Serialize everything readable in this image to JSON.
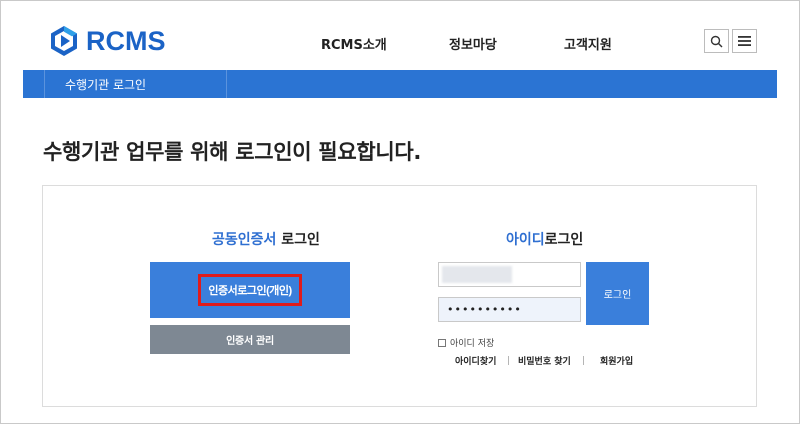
{
  "header": {
    "logo_text": "RCMS",
    "nav": [
      "RCMS소개",
      "정보마당",
      "고객지원"
    ],
    "brand_color": "#1b63c6",
    "icons": {
      "search": "search-icon",
      "menu": "hamburger-menu-icon"
    }
  },
  "breadcrumb": {
    "label": "수행기관 로그인",
    "bar_color": "#2b74d3"
  },
  "page": {
    "title": "수행기관 업무를 위해 로그인이 필요합니다."
  },
  "cert_login": {
    "title_highlight": "공동인증서",
    "title_rest": " 로그인",
    "login_button": "인증서로그인(개인)",
    "manage_button": "인증서 관리"
  },
  "id_login": {
    "title_highlight": "아이디",
    "title_rest": "로그인",
    "id_value": "",
    "password_value": "••••••••••",
    "login_button": "로그인",
    "save_id_label": "아이디 저장",
    "links": [
      "아이디찾기",
      "비밀번호 찾기",
      "회원가입"
    ]
  },
  "colors": {
    "accent": "#3a7fdb",
    "highlight_box": "#e01b1b",
    "secondary_button": "#7e8893"
  }
}
